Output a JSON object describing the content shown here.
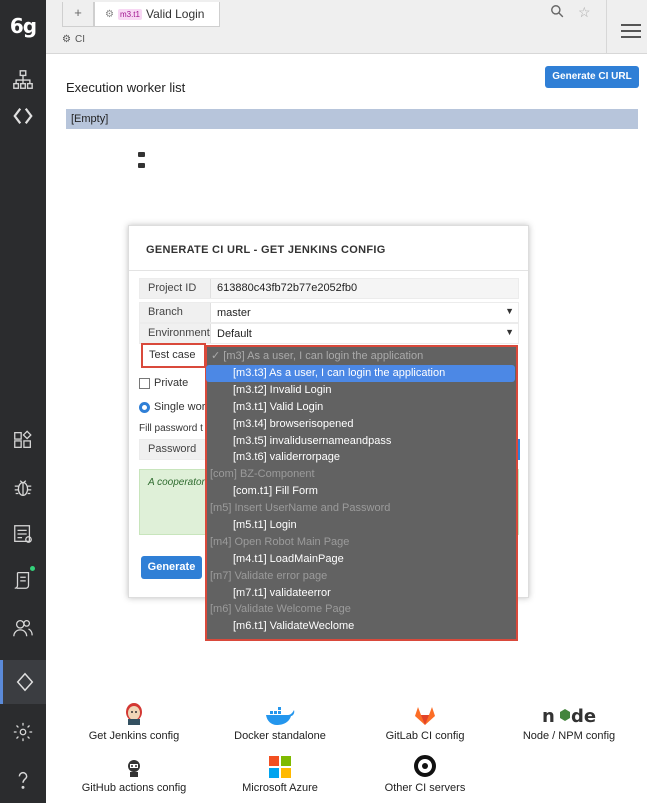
{
  "sidebar": {
    "logo": "6g",
    "icons": [
      "sitemap-icon",
      "code-icon",
      "apps-icon",
      "bug-icon",
      "report-icon",
      "script-icon",
      "users-icon",
      "ci-icon",
      "settings-icon",
      "help-icon"
    ]
  },
  "topbar": {
    "tab_plus": "+",
    "tab_badge": "m3.t1",
    "tab_label": "Valid Login",
    "subtab_label": "CI"
  },
  "main": {
    "title": "Execution worker list",
    "generate_ci_url": "Generate CI URL",
    "empty_label": "[Empty]"
  },
  "modal": {
    "title": "GENERATE CI URL - GET JENKINS CONFIG",
    "project_id_label": "Project ID",
    "project_id_value": "613880c43fb72b77e2052fb0",
    "branch_label": "Branch",
    "branch_value": "master",
    "environment_label": "Environment",
    "environment_value": "Default",
    "test_case_label": "Test case",
    "private_label": "Private",
    "single_label": "Single work",
    "fill_password_label": "Fill password t",
    "password_label": "Password",
    "coop_text": "A cooperator this feature c Validate realti complete tes",
    "generate_label": "Generate"
  },
  "dropdown": {
    "selected_header": "✓ [m3] As a user, I can login the application",
    "options": [
      {
        "type": "item",
        "label": "[m3.t3] As a user, I can login the application",
        "selected": true
      },
      {
        "type": "item",
        "label": "[m3.t2] Invalid Login"
      },
      {
        "type": "item",
        "label": "[m3.t1] Valid Login"
      },
      {
        "type": "item",
        "label": "[m3.t4] browserisopened"
      },
      {
        "type": "item",
        "label": "[m3.t5] invalidusernameandpass"
      },
      {
        "type": "item",
        "label": "[m3.t6] validerrorpage"
      },
      {
        "type": "group",
        "label": "[com] BZ-Component"
      },
      {
        "type": "item",
        "label": "[com.t1] Fill Form"
      },
      {
        "type": "group",
        "label": "[m5] Insert UserName and Password"
      },
      {
        "type": "item",
        "label": "[m5.t1] Login"
      },
      {
        "type": "group",
        "label": "[m4] Open Robot Main Page"
      },
      {
        "type": "item",
        "label": "[m4.t1] LoadMainPage"
      },
      {
        "type": "group",
        "label": "[m7] Validate error page"
      },
      {
        "type": "item",
        "label": "[m7.t1] validateerror"
      },
      {
        "type": "group",
        "label": "[m6] Validate Welcome Page"
      },
      {
        "type": "item",
        "label": "[m6.t1] ValidateWeclome"
      }
    ]
  },
  "ci_configs": [
    {
      "label": "Get Jenkins config",
      "icon": "jenkins-icon"
    },
    {
      "label": "Docker standalone",
      "icon": "docker-icon"
    },
    {
      "label": "GitLab CI config",
      "icon": "gitlab-icon"
    },
    {
      "label": "Node / NPM config",
      "icon": "node-icon"
    },
    {
      "label": "GitHub actions config",
      "icon": "github-icon"
    },
    {
      "label": "Microsoft Azure",
      "icon": "azure-icon"
    },
    {
      "label": "Other CI servers",
      "icon": "other-ci-icon"
    }
  ],
  "colors": {
    "accent": "#2f7fd6",
    "highlight": "#d9493b",
    "sidebar": "#2b2c2e"
  }
}
